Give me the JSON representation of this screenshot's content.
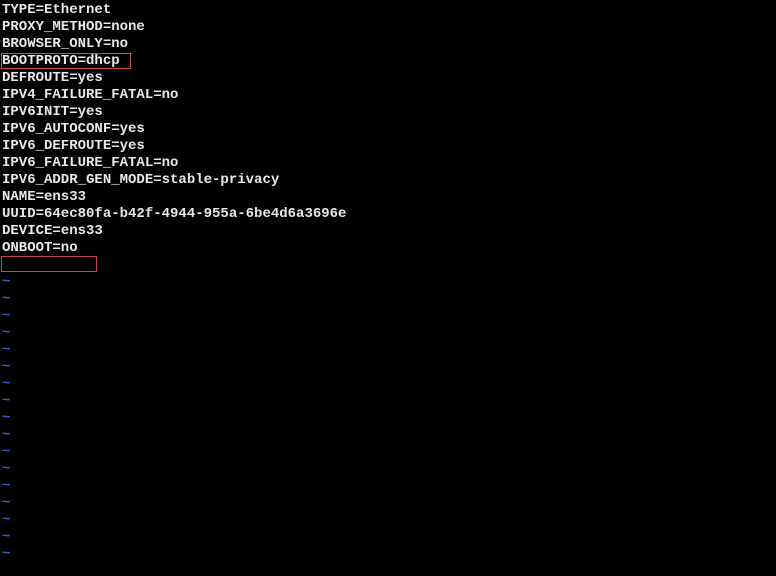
{
  "config_lines": [
    "TYPE=Ethernet",
    "PROXY_METHOD=none",
    "BROWSER_ONLY=no",
    "BOOTPROTO=dhcp",
    "DEFROUTE=yes",
    "IPV4_FAILURE_FATAL=no",
    "IPV6INIT=yes",
    "IPV6_AUTOCONF=yes",
    "IPV6_DEFROUTE=yes",
    "IPV6_FAILURE_FATAL=no",
    "IPV6_ADDR_GEN_MODE=stable-privacy",
    "NAME=ens33",
    "UUID=64ec80fa-b42f-4944-955a-6be4d6a3696e",
    "DEVICE=ens33",
    "ONBOOT=no"
  ],
  "empty_line": "",
  "tilde_char": "~",
  "tilde_count": 17,
  "highlights": {
    "line_3": "BOOTPROTO=dhcp",
    "line_14": "ONBOOT=no"
  }
}
